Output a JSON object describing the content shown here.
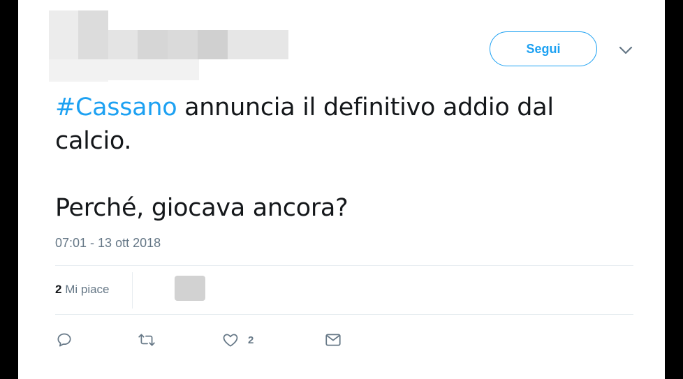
{
  "tweet": {
    "follow_label": "Segui",
    "hashtag": "#Cassano",
    "text_rest": " annuncia il definitivo addio dal calcio.",
    "text_line2": "Perché, giocava ancora?",
    "timestamp": "07:01 - 13 ott 2018",
    "likes_count": "2",
    "likes_label": "Mi piace",
    "action_like_count": "2"
  },
  "colors": {
    "accent": "#1da1f2",
    "text": "#14171a",
    "muted": "#657786",
    "border": "#e6ecf0"
  },
  "icons": [
    "chevron-down-icon",
    "reply-icon",
    "retweet-icon",
    "heart-icon",
    "mail-icon"
  ]
}
